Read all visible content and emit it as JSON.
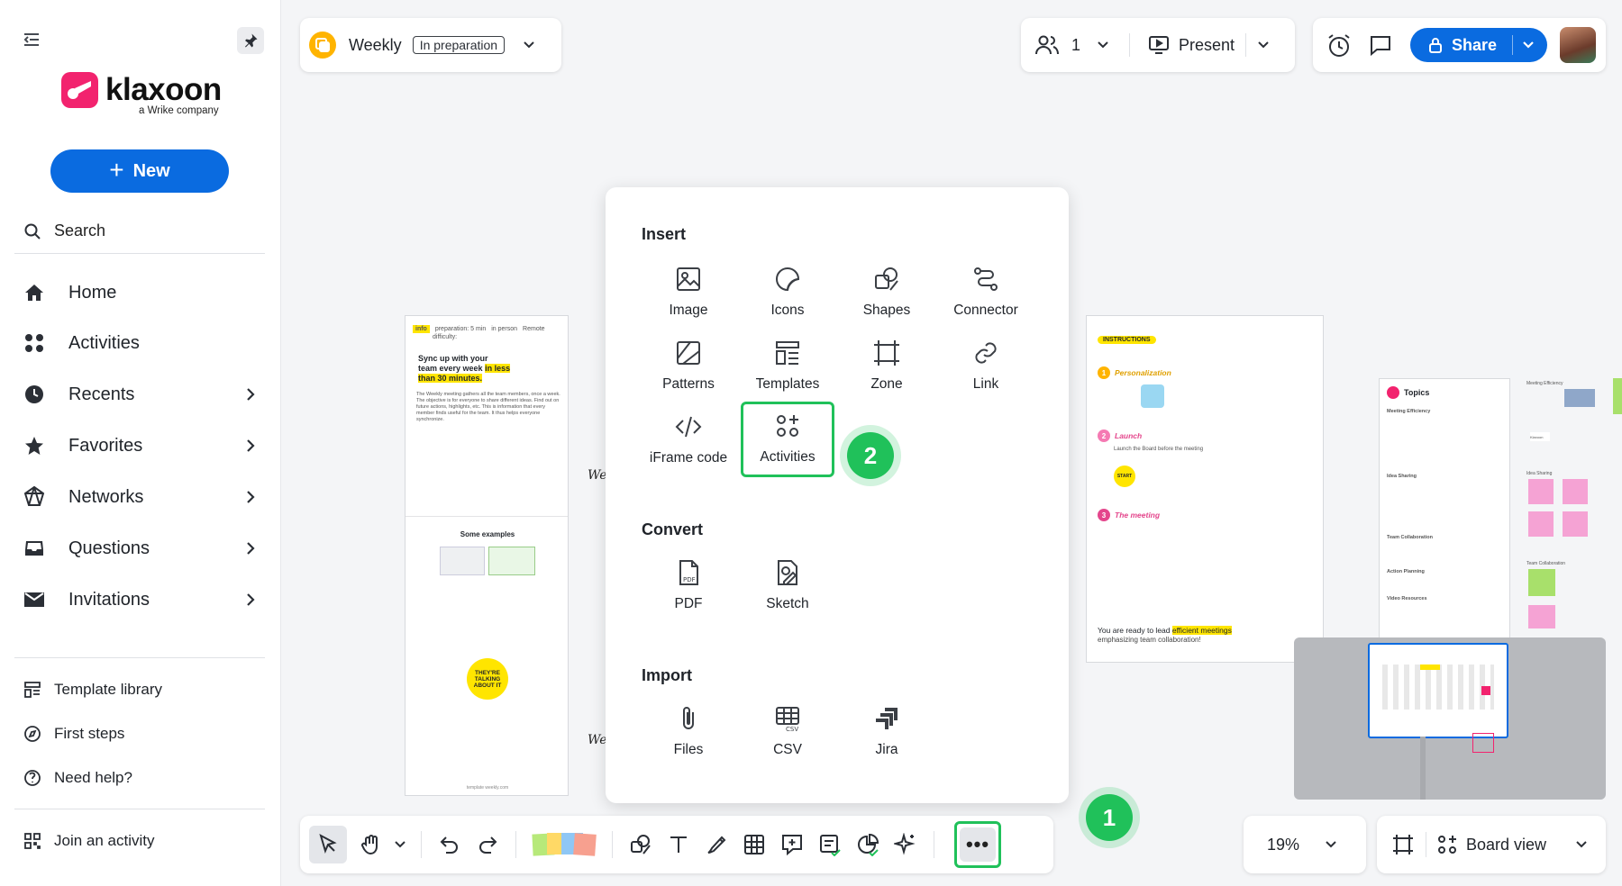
{
  "sidebar": {
    "logo_text": "klaxoon",
    "logo_sub": "a Wrike company",
    "new_label": "New",
    "search_label": "Search",
    "nav": [
      {
        "label": "Home"
      },
      {
        "label": "Activities"
      },
      {
        "label": "Recents"
      },
      {
        "label": "Favorites"
      },
      {
        "label": "Networks"
      },
      {
        "label": "Questions"
      },
      {
        "label": "Invitations"
      }
    ],
    "links": [
      {
        "label": "Template library"
      },
      {
        "label": "First steps"
      },
      {
        "label": "Need help?"
      }
    ],
    "join_label": "Join an activity"
  },
  "header": {
    "board_name": "Weekly",
    "status": "In preparation",
    "participants": "1",
    "present_label": "Present",
    "share_label": "Share"
  },
  "menu": {
    "insert_title": "Insert",
    "insert_items": [
      {
        "label": "Image"
      },
      {
        "label": "Icons"
      },
      {
        "label": "Shapes"
      },
      {
        "label": "Connector"
      },
      {
        "label": "Patterns"
      },
      {
        "label": "Templates"
      },
      {
        "label": "Zone"
      },
      {
        "label": "Link"
      },
      {
        "label": "iFrame code"
      },
      {
        "label": "Activities"
      }
    ],
    "convert_title": "Convert",
    "convert_items": [
      {
        "label": "PDF"
      },
      {
        "label": "Sketch"
      }
    ],
    "import_title": "Import",
    "import_items": [
      {
        "label": "Files"
      },
      {
        "label": "CSV"
      },
      {
        "label": "Jira"
      }
    ]
  },
  "steps": {
    "one": "1",
    "two": "2"
  },
  "toolbar": {
    "more_label": "•••"
  },
  "zoom": {
    "level": "19%"
  },
  "view": {
    "label": "Board view"
  },
  "canvas": {
    "doc1": {
      "tag": "info",
      "prep": "preparation: 5 min",
      "difficulty": "difficulty:",
      "in_person": "in person",
      "remote": "Remote",
      "heading_a": "Sync up with your",
      "heading_b": "team every week",
      "heading_hl1": "in less",
      "heading_hl2": "than 30 minutes.",
      "body": "The Weekly meeting gathers all the team members, once a week. The objective is for everyone to share different ideas. Find out on future actions, highlights, etc. This is information that every member finds useful for the team. It thus helps everyone synchronize.",
      "examples": "Some examples",
      "badge": "THEY'RE TALKING ABOUT IT",
      "footer": "template weekly.com"
    },
    "doc2": {
      "tag": "INSTRUCTIONS",
      "s1": "Personalization",
      "s2": "Launch",
      "s2_text": "Launch the Board before the meeting",
      "s3": "The meeting",
      "start": "START",
      "ready": "You are ready to lead",
      "ready_hl": "efficient meetings",
      "ready2": "emphasizing team collaboration!"
    },
    "doc3": {
      "title": "Topics",
      "sections": [
        "Meeting Efficiency",
        "Idea Sharing",
        "Team Collaboration",
        "Action Planning",
        "Video Resources"
      ]
    },
    "side_labels": [
      "Meeting Efficiency",
      "Idea Sharing",
      "Team Collaboration"
    ],
    "side_brand": "Klaxoon",
    "handwriting": [
      "We",
      "We"
    ]
  },
  "colors": {
    "accent_blue": "#0a6be0",
    "highlight_green": "#20c15a",
    "brand_pink": "#f2236e",
    "board_icon": "#ffb400"
  }
}
